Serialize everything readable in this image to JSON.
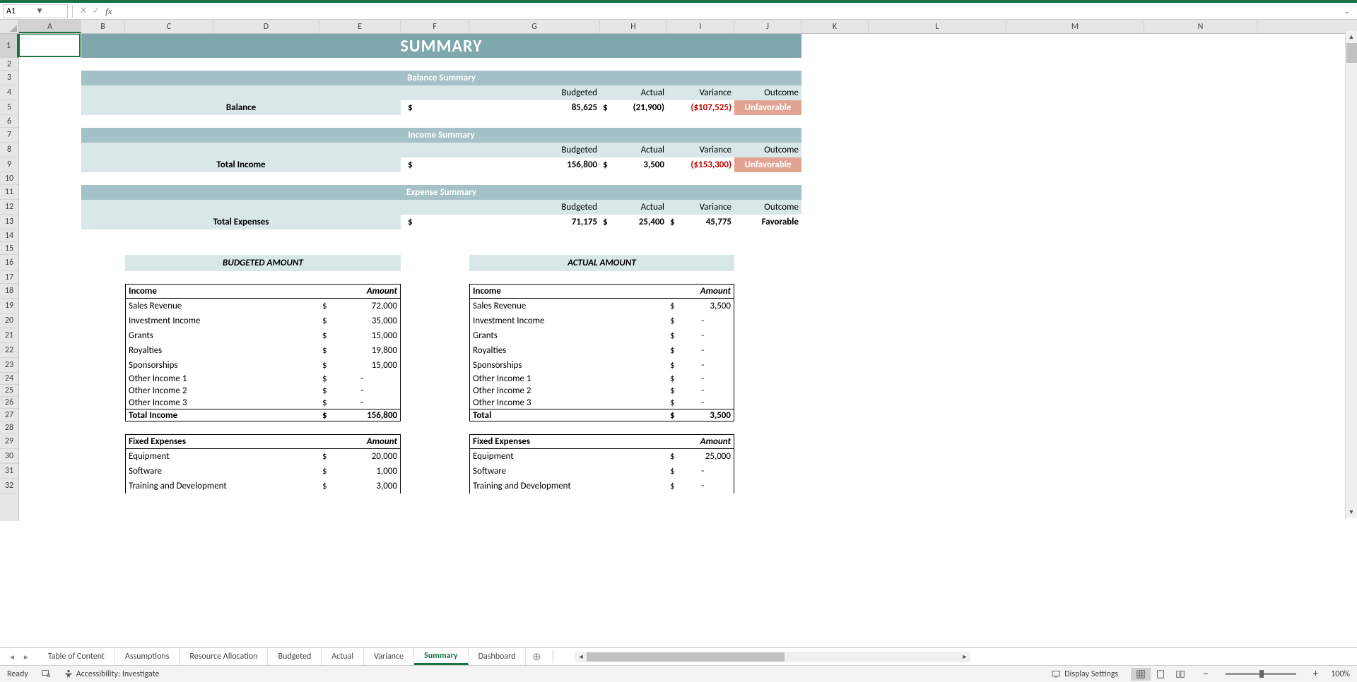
{
  "nameBox": "A1",
  "formula": "",
  "columns": [
    "A",
    "B",
    "C",
    "D",
    "E",
    "F",
    "G",
    "H",
    "I",
    "J",
    "K",
    "L",
    "M",
    "N"
  ],
  "colWidths": {
    "A": 88,
    "B": 62,
    "C": 125,
    "D": 150,
    "E": 115,
    "F": 97,
    "G": 185,
    "H": 95,
    "I": 95,
    "J": 95,
    "K": 95,
    "L": 195,
    "M": 195,
    "N": 160
  },
  "rowCount": 32,
  "rowHeights": {
    "1": 34,
    "2": 18,
    "3": 21,
    "4": 21,
    "5": 21,
    "6": 18,
    "7": 21,
    "8": 21,
    "9": 21,
    "10": 18,
    "11": 21,
    "12": 21,
    "13": 21,
    "14": 18,
    "15": 18,
    "16": 23,
    "17": 18,
    "18": 21,
    "19": 21,
    "20": 21,
    "21": 21,
    "22": 21,
    "23": 21,
    "24": 17,
    "25": 17,
    "26": 17,
    "27": 18,
    "28": 18,
    "29": 21,
    "30": 21,
    "31": 21,
    "32": 21
  },
  "sheet": {
    "title": "SUMMARY",
    "balance": {
      "header": "Balance Summary",
      "rowLabel": "Balance",
      "cols": [
        "Budgeted",
        "Actual",
        "Variance",
        "Outcome"
      ],
      "currency": "$",
      "budgeted": "85,625",
      "actual": "(21,900)",
      "variance": "($107,525)",
      "outcome": "Unfavorable"
    },
    "income": {
      "header": "Income Summary",
      "rowLabel": "Total Income",
      "cols": [
        "Budgeted",
        "Actual",
        "Variance",
        "Outcome"
      ],
      "currency": "$",
      "budgeted": "156,800",
      "actual": "3,500",
      "variance": "($153,300)",
      "outcome": "Unfavorable"
    },
    "expense": {
      "header": "Expense Summary",
      "rowLabel": "Total Expenses",
      "cols": [
        "Budgeted",
        "Actual",
        "Variance",
        "Outcome"
      ],
      "currency": "$",
      "budgeted": "71,175",
      "actual": "25,400",
      "variance": "45,775",
      "outcome": "Favorable"
    },
    "budgetedHeader": "BUDGETED AMOUNT",
    "actualHeader": "ACTUAL AMOUNT",
    "budgetedIncome": {
      "title": "Income",
      "amountLabel": "Amount",
      "rows": [
        {
          "label": "Sales Revenue",
          "cur": "$",
          "val": "72,000"
        },
        {
          "label": "Investment Income",
          "cur": "$",
          "val": "35,000"
        },
        {
          "label": "Grants",
          "cur": "$",
          "val": "15,000"
        },
        {
          "label": "Royalties",
          "cur": "$",
          "val": "19,800"
        },
        {
          "label": "Sponsorships",
          "cur": "$",
          "val": "15,000"
        },
        {
          "label": "Other Income 1",
          "cur": "$",
          "val": "-"
        },
        {
          "label": "Other Income 2",
          "cur": "$",
          "val": "-"
        },
        {
          "label": "Other Income 3",
          "cur": "$",
          "val": "-"
        }
      ],
      "totalLabel": "Total Income",
      "totalCur": "$",
      "totalVal": "156,800"
    },
    "actualIncome": {
      "title": "Income",
      "amountLabel": "Amount",
      "rows": [
        {
          "label": "Sales Revenue",
          "cur": "$",
          "val": "3,500"
        },
        {
          "label": "Investment Income",
          "cur": "$",
          "val": "-"
        },
        {
          "label": "Grants",
          "cur": "$",
          "val": "-"
        },
        {
          "label": "Royalties",
          "cur": "$",
          "val": "-"
        },
        {
          "label": "Sponsorships",
          "cur": "$",
          "val": "-"
        },
        {
          "label": "Other Income 1",
          "cur": "$",
          "val": "-"
        },
        {
          "label": "Other Income 2",
          "cur": "$",
          "val": "-"
        },
        {
          "label": "Other Income 3",
          "cur": "$",
          "val": "-"
        }
      ],
      "totalLabel": "Total",
      "totalCur": "$",
      "totalVal": "3,500"
    },
    "budgetedFixed": {
      "title": "Fixed Expenses",
      "amountLabel": "Amount",
      "rows": [
        {
          "label": "Equipment",
          "cur": "$",
          "val": "20,000"
        },
        {
          "label": "Software",
          "cur": "$",
          "val": "1,000"
        },
        {
          "label": "Training and Development",
          "cur": "$",
          "val": "3,000"
        }
      ]
    },
    "actualFixed": {
      "title": "Fixed Expenses",
      "amountLabel": "Amount",
      "rows": [
        {
          "label": "Equipment",
          "cur": "$",
          "val": "25,000"
        },
        {
          "label": "Software",
          "cur": "$",
          "val": "-"
        },
        {
          "label": "Training and Development",
          "cur": "$",
          "val": "-"
        }
      ]
    }
  },
  "tabs": [
    "Table of Content",
    "Assumptions",
    "Resource Allocation",
    "Budgeted",
    "Actual",
    "Variance",
    "Summary",
    "Dashboard"
  ],
  "activeTab": "Summary",
  "status": {
    "ready": "Ready",
    "access": "Accessibility: Investigate",
    "display": "Display Settings",
    "zoom": "100%"
  }
}
